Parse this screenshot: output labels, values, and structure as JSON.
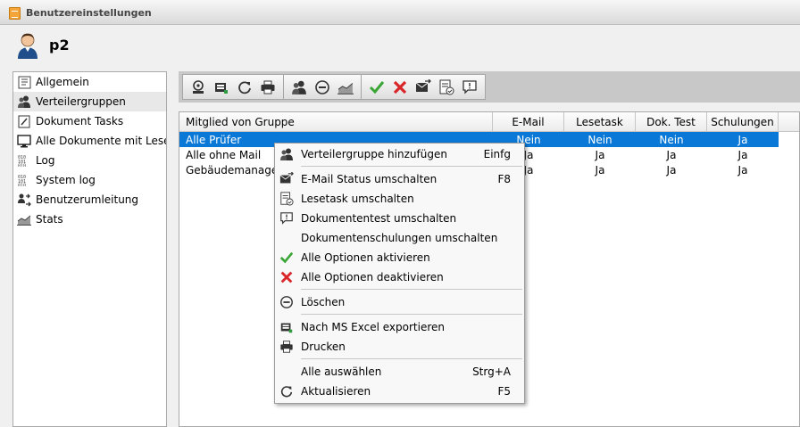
{
  "window": {
    "title": "Benutzereinstellungen"
  },
  "user": {
    "name": "p2"
  },
  "sidebar": {
    "items": [
      {
        "label": "Allgemein",
        "icon": "form-icon"
      },
      {
        "label": "Verteilergruppen",
        "icon": "users-icon",
        "active": true
      },
      {
        "label": "Dokument Tasks",
        "icon": "edit-document-icon"
      },
      {
        "label": "Alle Dokumente mit Lesetask",
        "icon": "monitor-icon"
      },
      {
        "label": "Log",
        "icon": "binary-log-icon"
      },
      {
        "label": "System log",
        "icon": "binary-log-icon"
      },
      {
        "label": "Benutzerumleitung",
        "icon": "redirect-icon"
      },
      {
        "label": "Stats",
        "icon": "area-chart-icon"
      }
    ]
  },
  "toolbar": {
    "icons": [
      "add-group-icon",
      "excel-export-icon",
      "refresh-icon",
      "print-icon",
      "users-icon",
      "minus-circle-icon",
      "area-chart-icon",
      "check-icon",
      "cross-icon",
      "mail-toggle-icon",
      "read-task-icon",
      "comment-icon"
    ]
  },
  "grid": {
    "columns": [
      "Mitglied von Gruppe",
      "E-Mail",
      "Lesetask",
      "Dok. Test",
      "Schulungen"
    ],
    "rows": [
      {
        "group": "Alle Prüfer",
        "email": "Nein",
        "lesetask": "Nein",
        "doktest": "Nein",
        "schulungen": "Ja",
        "selected": true
      },
      {
        "group": "Alle ohne Mail",
        "email": "Ja",
        "lesetask": "Ja",
        "doktest": "Ja",
        "schulungen": "Ja"
      },
      {
        "group": "Gebäudemanager",
        "email": "Ja",
        "lesetask": "Ja",
        "doktest": "Ja",
        "schulungen": "Ja"
      }
    ]
  },
  "context_menu": {
    "items": {
      "add_group": {
        "label": "Verteilergruppe hinzufügen",
        "shortcut": "Einfg",
        "icon": "users-icon"
      },
      "email_toggle": {
        "label": "E-Mail Status umschalten",
        "shortcut": "F8",
        "icon": "mail-toggle-icon"
      },
      "readtask_toggle": {
        "label": "Lesetask umschalten",
        "icon": "read-task-icon"
      },
      "doctest_toggle": {
        "label": "Dokumententest umschalten",
        "icon": "comment-icon"
      },
      "training_toggle": {
        "label": "Dokumentenschulungen umschalten"
      },
      "enable_all": {
        "label": "Alle Optionen aktivieren",
        "icon": "check-icon"
      },
      "disable_all": {
        "label": "Alle Optionen deaktivieren",
        "icon": "cross-icon"
      },
      "delete": {
        "label": "Löschen",
        "icon": "minus-circle-icon"
      },
      "export_excel": {
        "label": "Nach MS Excel exportieren",
        "icon": "excel-export-icon"
      },
      "print": {
        "label": "Drucken",
        "icon": "print-icon"
      },
      "select_all": {
        "label": "Alle auswählen",
        "shortcut": "Strg+A"
      },
      "refresh": {
        "label": "Aktualisieren",
        "shortcut": "F5",
        "icon": "refresh-icon"
      }
    }
  },
  "colors": {
    "selection": "#0a78d7",
    "check": "#3aa635",
    "cross": "#d8262a"
  }
}
